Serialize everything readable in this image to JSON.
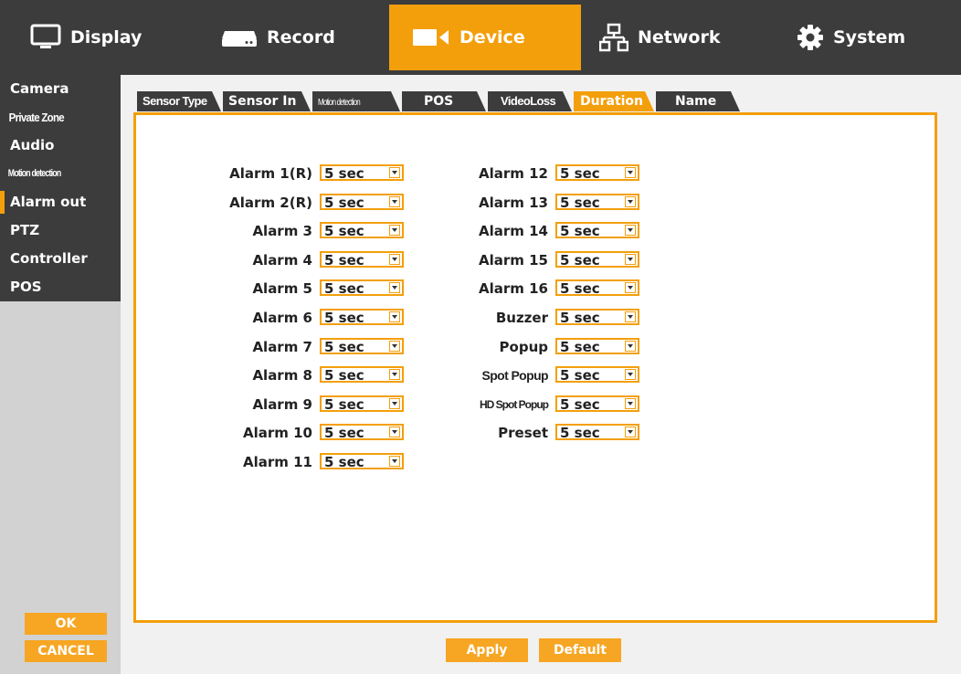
{
  "top_tabs": [
    {
      "label": "Display",
      "icon": "monitor-icon"
    },
    {
      "label": "Record",
      "icon": "recorder-icon"
    },
    {
      "label": "Device",
      "icon": "camera-icon"
    },
    {
      "label": "Network",
      "icon": "network-icon"
    },
    {
      "label": "System",
      "icon": "gear-icon"
    }
  ],
  "active_top_tab": "Device",
  "sidebar": {
    "items": [
      "Camera",
      "Private Zone",
      "Audio",
      "Motion detection",
      "Alarm out",
      "PTZ",
      "Controller",
      "POS"
    ],
    "active": "Alarm out",
    "ok_label": "OK",
    "cancel_label": "CANCEL"
  },
  "sub_tabs": [
    "Sensor Type",
    "Sensor In",
    "Motion detection",
    "POS",
    "VideoLoss",
    "Duration",
    "Name"
  ],
  "active_sub_tab": "Duration",
  "left_column": [
    {
      "label": "Alarm 1(R)",
      "value": "5 sec"
    },
    {
      "label": "Alarm 2(R)",
      "value": "5 sec"
    },
    {
      "label": "Alarm 3",
      "value": "5 sec"
    },
    {
      "label": "Alarm 4",
      "value": "5 sec"
    },
    {
      "label": "Alarm 5",
      "value": "5 sec"
    },
    {
      "label": "Alarm 6",
      "value": "5 sec"
    },
    {
      "label": "Alarm 7",
      "value": "5 sec"
    },
    {
      "label": "Alarm 8",
      "value": "5 sec"
    },
    {
      "label": "Alarm 9",
      "value": "5 sec"
    },
    {
      "label": "Alarm 10",
      "value": "5 sec"
    },
    {
      "label": "Alarm 11",
      "value": "5 sec"
    }
  ],
  "right_column": [
    {
      "label": "Alarm 12",
      "value": "5 sec"
    },
    {
      "label": "Alarm 13",
      "value": "5 sec"
    },
    {
      "label": "Alarm 14",
      "value": "5 sec"
    },
    {
      "label": "Alarm 15",
      "value": "5 sec"
    },
    {
      "label": "Alarm 16",
      "value": "5 sec"
    },
    {
      "label": "Buzzer",
      "value": "5 sec"
    },
    {
      "label": "Popup",
      "value": "5 sec"
    },
    {
      "label": "Spot Popup",
      "value": "5 sec"
    },
    {
      "label": "HD Spot Popup",
      "value": "5 sec"
    },
    {
      "label": "Preset",
      "value": "5 sec"
    }
  ],
  "buttons": {
    "apply": "Apply",
    "default": "Default"
  },
  "colors": {
    "accent": "#f39f0b",
    "dark": "#3c3c3c",
    "sidebar_bg": "#d2d2d2"
  }
}
